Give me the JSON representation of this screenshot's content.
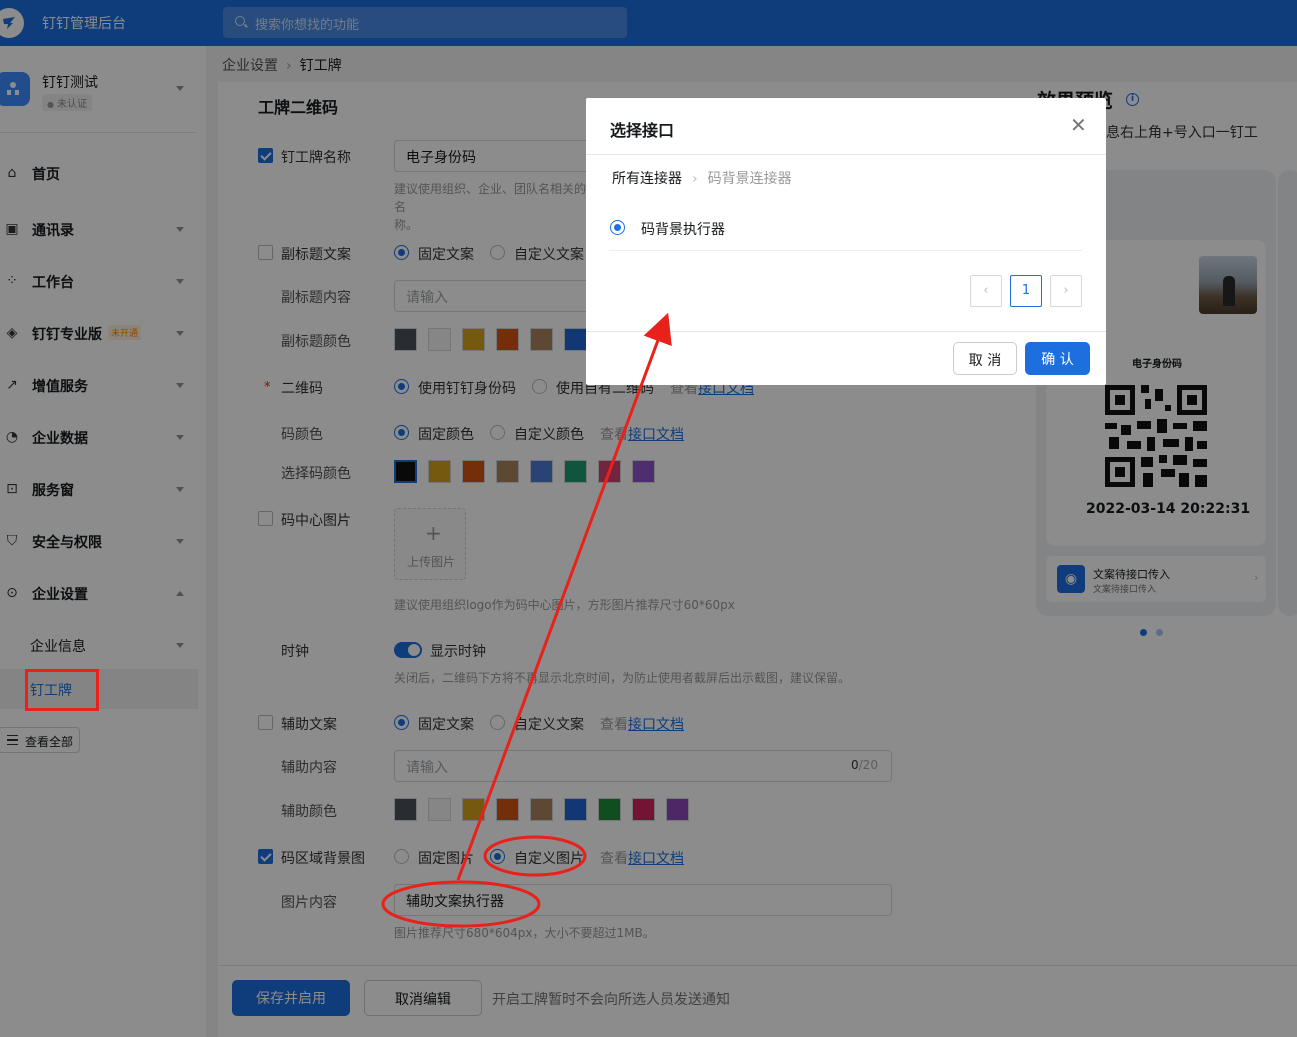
{
  "topbar": {
    "app_title": "钉钉管理后台",
    "search_placeholder": "搜索你想找的功能"
  },
  "sidebar": {
    "org_name": "钉钉测试",
    "org_status": "未认证",
    "items": [
      {
        "label": "首页",
        "icon": "home-icon"
      },
      {
        "label": "通讯录",
        "icon": "contacts-icon"
      },
      {
        "label": "工作台",
        "icon": "grid-icon"
      },
      {
        "label": "钉钉专业版",
        "icon": "diamond-icon",
        "badge": "未开通"
      },
      {
        "label": "增值服务",
        "icon": "chart-icon"
      },
      {
        "label": "企业数据",
        "icon": "data-icon"
      },
      {
        "label": "服务窗",
        "icon": "window-icon"
      },
      {
        "label": "安全与权限",
        "icon": "shield-icon"
      },
      {
        "label": "企业设置",
        "icon": "settings-icon"
      }
    ],
    "sub_items": [
      {
        "label": "企业信息"
      },
      {
        "label": "钉工牌"
      }
    ],
    "view_all": "查看全部"
  },
  "breadcrumb": {
    "parent": "企业设置",
    "current": "钉工牌"
  },
  "form": {
    "section_title": "工牌二维码",
    "badge_name_label": "钉工牌名称",
    "badge_name_value": "电子身份码",
    "badge_name_hint": "建议使用组织、企业、团队名相关的名\n称。",
    "subtitle_label": "副标题文案",
    "subtitle_opt_fixed": "固定文案",
    "subtitle_opt_custom": "自定义文案",
    "subtitle_content_label": "副标题内容",
    "subtitle_content_placeholder": "请输入",
    "subtitle_color_label": "副标题颜色",
    "qr_label": "二维码",
    "qr_opt_dingtalk": "使用钉钉身份码",
    "qr_opt_own": "使用自有二维码",
    "view_prefix": "查看",
    "api_doc": "接口文档",
    "code_color_label": "码颜色",
    "code_color_opt_fixed": "固定颜色",
    "code_color_opt_custom": "自定义颜色",
    "select_color_label": "选择码颜色",
    "center_image_label": "码中心图片",
    "upload_label": "上传图片",
    "center_image_hint": "建议使用组织logo作为码中心图片，方形图片推荐尺寸60*60px",
    "clock_label": "时钟",
    "clock_toggle_label": "显示时钟",
    "clock_hint": "关闭后，二维码下方将不再显示北京时间，为防止使用者截屏后出示截图，建议保留。",
    "aux_text_label": "辅助文案",
    "aux_opt_fixed": "固定文案",
    "aux_opt_custom": "自定义文案",
    "aux_content_label": "辅助内容",
    "aux_content_placeholder": "请输入",
    "aux_counter_current": "0",
    "aux_counter_max": "/20",
    "aux_color_label": "辅助颜色",
    "bg_label": "码区域背景图",
    "bg_opt_fixed": "固定图片",
    "bg_opt_custom": "自定义图片",
    "image_content_label": "图片内容",
    "image_content_value": "辅助文案执行器",
    "image_hint": "图片推荐尺寸680*604px，大小不要超过1MB。"
  },
  "swatches": {
    "subtitle": [
      "#4b5259",
      "#f5f5f5",
      "#d6a31b",
      "#d45513",
      "#a9845d",
      "#1f66d6"
    ],
    "code": [
      "#111111",
      "#d6a31b",
      "#d45513",
      "#a9845d",
      "#4a7bd4",
      "#1e9b72",
      "#d4426f",
      "#8e54c8"
    ],
    "aux": [
      "#4b5259",
      "#f5f5f5",
      "#d6a31b",
      "#d45513",
      "#a9845d",
      "#1f66d6",
      "#1e8f3a",
      "#d4265f",
      "#8e48b8"
    ]
  },
  "footer": {
    "save": "保存并启用",
    "cancel": "取消编辑",
    "note": "开启工牌暂时不会向所选人员发送通知"
  },
  "preview": {
    "title": "效果预览",
    "desc": "息右上角+号入口一钉工",
    "card_name": "电子身份码",
    "time": "2022-03-14 20:22:31",
    "entry_title": "文案待接口传入",
    "entry_sub": "文案待接口传入"
  },
  "modal": {
    "title": "选择接口",
    "crumb_root": "所有连接器",
    "crumb_current": "码背景连接器",
    "option": "码背景执行器",
    "page": "1",
    "cancel": "取 消",
    "confirm": "确 认"
  },
  "colors": {
    "primary": "#1d6fe0",
    "annotation": "#e8211b"
  }
}
